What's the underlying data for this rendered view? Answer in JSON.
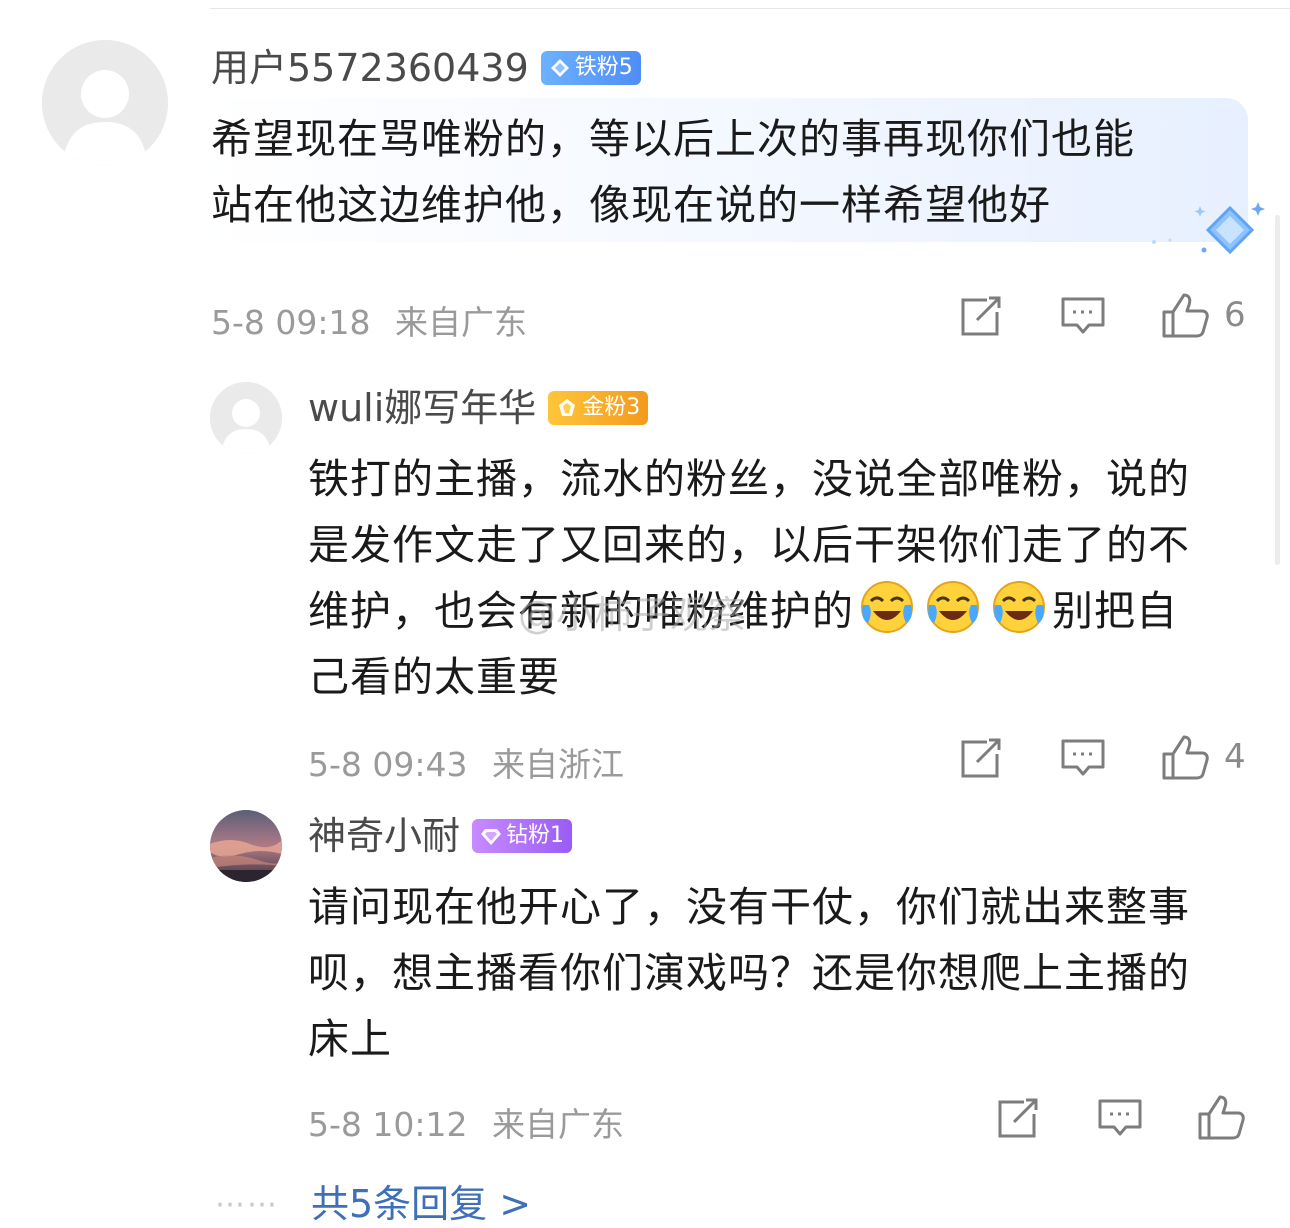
{
  "comment_main": {
    "username": "用户5572360439",
    "badge": "铁粉5",
    "text_line1": "希望现在骂唯粉的，等以后上次的事再现你们也能",
    "text_line2": "站在他这边维护他，像现在说的一样希望他好",
    "date": "5-8 09:18",
    "location": "来自广东",
    "likes": "6"
  },
  "replies": [
    {
      "username": "wuli娜写年华",
      "badge": "金粉3",
      "text_line1": "铁打的主播，流水的粉丝，没说全部唯粉，说的",
      "text_line2": "是发作文走了又回来的，以后干架你们走了的不",
      "text_line3_a": "维护，也会有新的唯粉维护的",
      "text_line3_b": "别把自",
      "text_line4": "己看的太重要",
      "date": "5-8 09:43",
      "location": "来自浙江",
      "likes": "4"
    },
    {
      "username": "神奇小耐",
      "badge": "钻粉1",
      "text_line1": "请问现在他开心了，没有干仗，你们就出来整事",
      "text_line2": "呗，想主播看你们演戏吗？还是你想爬上主播的",
      "text_line3": "床上",
      "date": "5-8 10:12",
      "location": "来自广东",
      "likes": ""
    }
  ],
  "more_replies": {
    "dots": "⋯⋯",
    "label": "共5条回复 >"
  },
  "watermark": "@小柿子观察"
}
